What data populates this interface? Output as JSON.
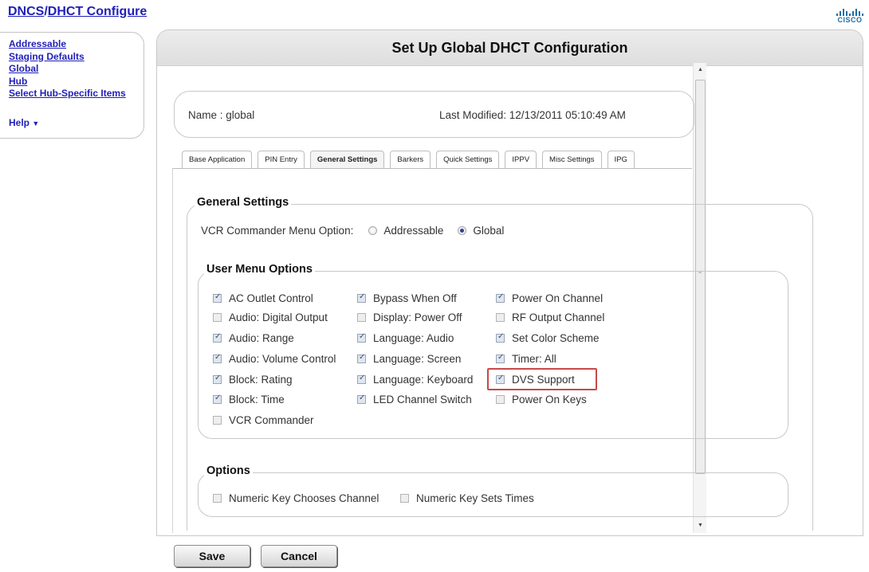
{
  "header": {
    "title_part1": "DNCS",
    "title_sep": "/",
    "title_part2": "DHCT Configure",
    "logo_word": "CISCO"
  },
  "nav": {
    "items": [
      {
        "label": "Addressable"
      },
      {
        "label": "Staging Defaults"
      },
      {
        "label": "Global"
      },
      {
        "label": "Hub"
      },
      {
        "label": "Select Hub-Specific Items"
      }
    ],
    "help_label": "Help",
    "help_arrow": "▼"
  },
  "page": {
    "title": "Set Up Global DHCT Configuration",
    "name_label": "Name : global",
    "last_modified": "Last Modified: 12/13/2011 05:10:49 AM"
  },
  "tabs": [
    {
      "label": "Base Application",
      "active": false
    },
    {
      "label": "PIN Entry",
      "active": false
    },
    {
      "label": "General Settings",
      "active": true
    },
    {
      "label": "Barkers",
      "active": false
    },
    {
      "label": "Quick Settings",
      "active": false
    },
    {
      "label": "IPPV",
      "active": false
    },
    {
      "label": "Misc Settings",
      "active": false
    },
    {
      "label": "IPG",
      "active": false
    }
  ],
  "general": {
    "legend": "General Settings",
    "vcr_label": "VCR Commander Menu Option:",
    "vcr_options": [
      {
        "label": "Addressable",
        "selected": false
      },
      {
        "label": "Global",
        "selected": true
      }
    ]
  },
  "user_menu": {
    "legend": "User Menu Options",
    "col1": [
      {
        "label": "AC Outlet Control",
        "checked": true
      },
      {
        "label": "Audio: Digital Output",
        "checked": false
      },
      {
        "label": "Audio: Range",
        "checked": true
      },
      {
        "label": "Audio: Volume Control",
        "checked": true
      },
      {
        "label": "Block: Rating",
        "checked": true
      },
      {
        "label": "Block: Time",
        "checked": true
      },
      {
        "label": "VCR Commander",
        "checked": false
      }
    ],
    "col2": [
      {
        "label": "Bypass When Off",
        "checked": true
      },
      {
        "label": "Display: Power Off",
        "checked": false
      },
      {
        "label": "Language: Audio",
        "checked": true
      },
      {
        "label": "Language: Screen",
        "checked": true
      },
      {
        "label": "Language: Keyboard",
        "checked": true
      },
      {
        "label": "LED Channel Switch",
        "checked": true
      }
    ],
    "col3": [
      {
        "label": "Power On Channel",
        "checked": true
      },
      {
        "label": "RF Output Channel",
        "checked": false
      },
      {
        "label": "Set Color Scheme",
        "checked": true
      },
      {
        "label": "Timer: All",
        "checked": true
      },
      {
        "label": "DVS Support",
        "checked": true,
        "highlighted": true
      },
      {
        "label": "Power On Keys",
        "checked": false
      }
    ]
  },
  "options": {
    "legend": "Options",
    "items": [
      {
        "label": "Numeric Key Chooses Channel",
        "checked": false
      },
      {
        "label": "Numeric Key Sets Times",
        "checked": false
      }
    ]
  },
  "buttons": {
    "save_label": "Save",
    "cancel_label": "Cancel"
  }
}
